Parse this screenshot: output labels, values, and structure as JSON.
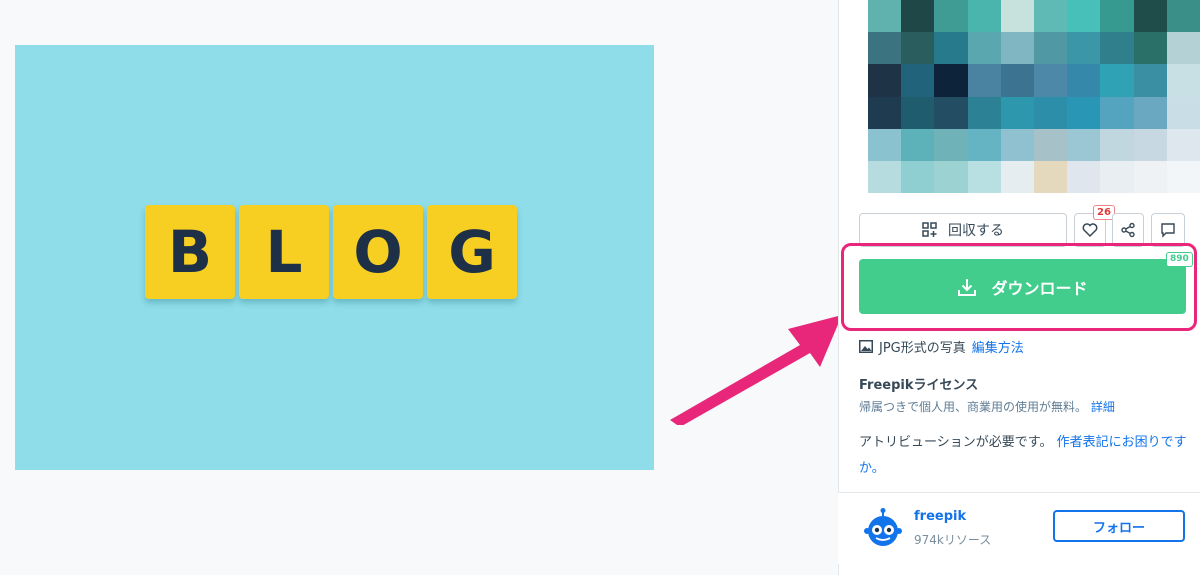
{
  "preview": {
    "tiles": [
      "B",
      "L",
      "O",
      "G"
    ]
  },
  "mosaic": {
    "colors": [
      "#5fb2ad",
      "#1f4747",
      "#3f9c94",
      "#4ab5ad",
      "#c7e1dd",
      "#5fbab5",
      "#48c0ba",
      "#369a90",
      "#1e4d4a",
      "#3a8f89",
      "#3b7480",
      "#2a5e5e",
      "#27798c",
      "#5aa7b0",
      "#7fb6c2",
      "#4f98a4",
      "#3b97a7",
      "#2f7f8c",
      "#2a7068",
      "#b4d2d6",
      "#1f3347",
      "#21637a",
      "#0c2339",
      "#4a82a2",
      "#3c7390",
      "#4d88a8",
      "#3688aa",
      "#2fa2b5",
      "#3b8fa3",
      "#c8dfe4",
      "#1f3b50",
      "#1e5c6e",
      "#234d62",
      "#2d8195",
      "#2c97ad",
      "#2c8ea9",
      "#2a96b5",
      "#54a4bf",
      "#6aa8c2",
      "#c8dde5",
      "#8bc2cf",
      "#5db1b8",
      "#6fb2b7",
      "#65b4c4",
      "#8fc1d1",
      "#a6c2c8",
      "#9ac7d3",
      "#c1d7e0",
      "#c7d8e3",
      "#dde7ed",
      "#b7dce0",
      "#8fcfd2",
      "#9dd2d3",
      "#b8dfe2",
      "#e6edf0",
      "#e4d9bd",
      "#dfe6ee",
      "#e8eef2",
      "#eef2f5",
      "#f3f6f8"
    ]
  },
  "actions": {
    "collect_label": "回収する",
    "like_count": "26"
  },
  "download": {
    "label": "ダウンロード",
    "count": "890"
  },
  "format": {
    "label": "JPG形式の写真",
    "edit_link": "編集方法"
  },
  "license": {
    "title": "Freepikライセンス",
    "desc": "帰属つきで個人用、商業用の使用が無料。",
    "detail_link": "詳細",
    "attribution": "アトリビューションが必要です。",
    "attribution_link": "作者表記にお困りですか。"
  },
  "author": {
    "name": "freepik",
    "resources": "974kリソース",
    "follow_label": "フォロー"
  },
  "colors": {
    "download_green": "#42cd8d",
    "highlight_pink": "#e8277a",
    "link_blue": "#1273eb",
    "preview_bg": "#8edde9",
    "tile_yellow": "#f7cf23"
  }
}
